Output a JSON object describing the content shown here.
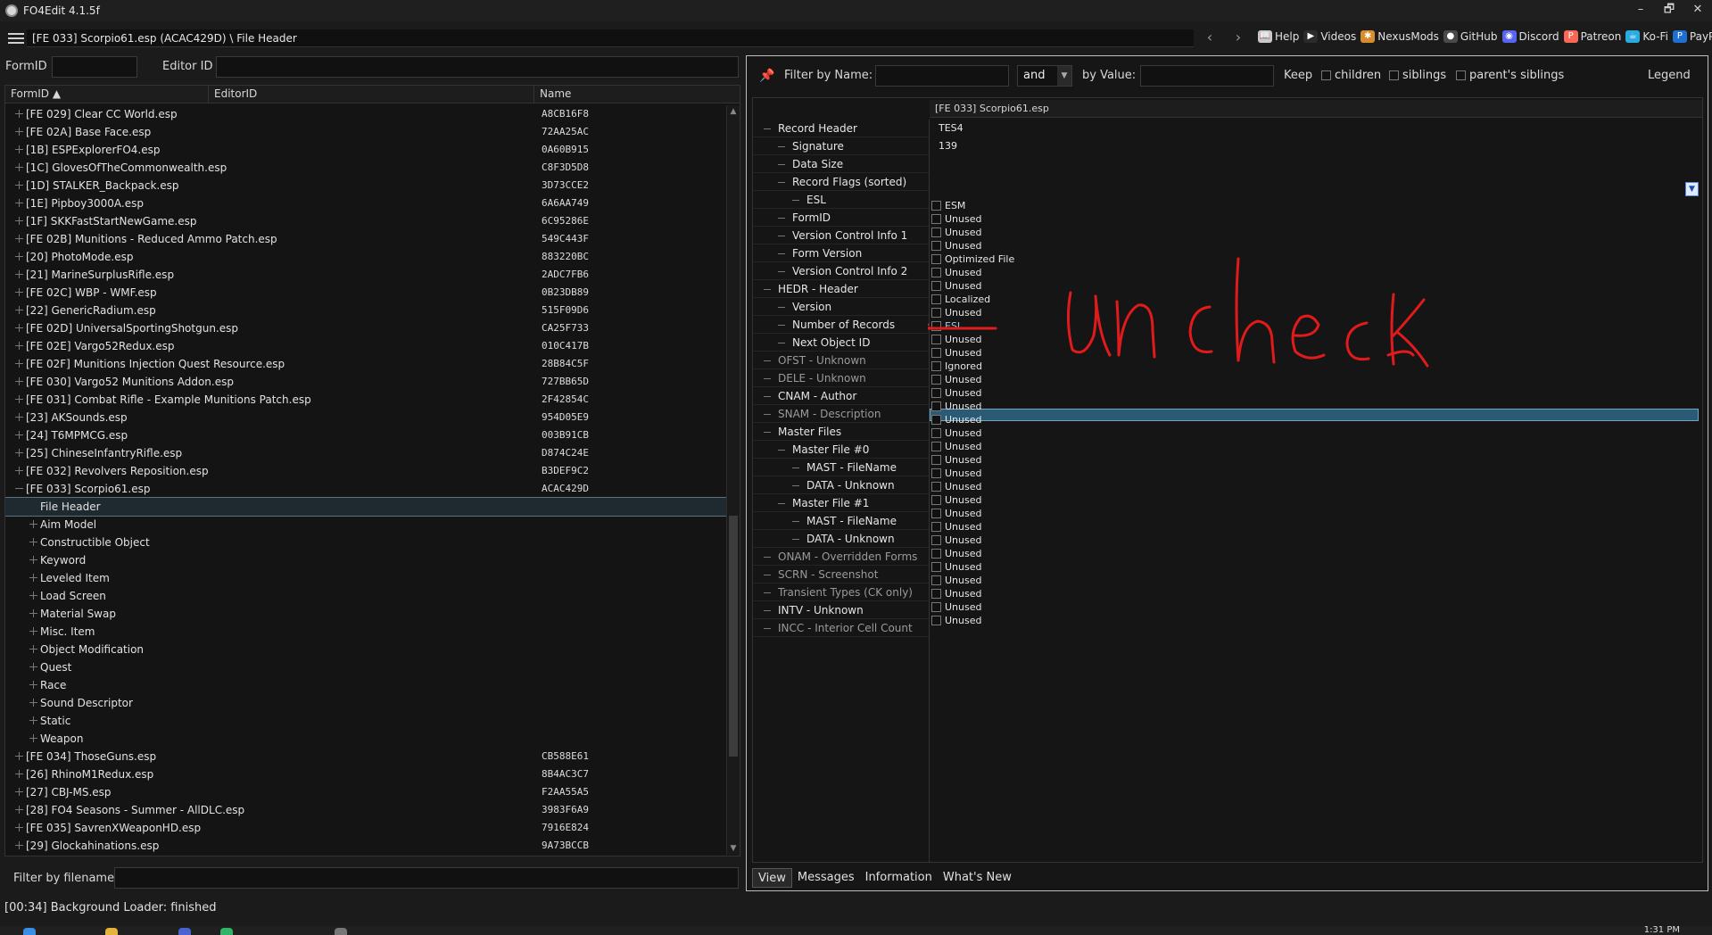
{
  "window": {
    "title": "FO4Edit 4.1.5f",
    "controls": [
      "–",
      "🗗",
      "✕"
    ]
  },
  "toolbar": {
    "breadcrumb": "[FE 033] Scorpio61.esp (ACAC429D) \\ File Header",
    "back": "‹",
    "forward": "›",
    "links": [
      {
        "label": "Help",
        "icon": "book-icon",
        "color": "#c9c9c9",
        "glyph": "📖"
      },
      {
        "label": "Videos",
        "icon": "videos-icon",
        "color": "#2b2b2b",
        "glyph": "▶"
      },
      {
        "label": "NexusMods",
        "icon": "nexus-icon",
        "color": "#d98c2b",
        "glyph": "✱"
      },
      {
        "label": "GitHub",
        "icon": "github-icon",
        "color": "#4a4a4a",
        "glyph": "●"
      },
      {
        "label": "Discord",
        "icon": "discord-icon",
        "color": "#5865f2",
        "glyph": "◉"
      },
      {
        "label": "Patreon",
        "icon": "patreon-icon",
        "color": "#f96854",
        "glyph": "P"
      },
      {
        "label": "Ko-Fi",
        "icon": "kofi-icon",
        "color": "#29abe0",
        "glyph": "☕"
      },
      {
        "label": "PayPal",
        "icon": "paypal-icon",
        "color": "#1f6fd1",
        "glyph": "P"
      }
    ]
  },
  "left": {
    "formid_label": "FormID",
    "editorid_label": "Editor ID",
    "columns": [
      "FormID",
      "EditorID",
      "Name"
    ],
    "rows": [
      {
        "name": "[FE 029] Clear CC World.esp",
        "value": "A8CB16F8",
        "depth": 0,
        "exp": "plus"
      },
      {
        "name": "[FE 02A] Base Face.esp",
        "value": "72AA25AC",
        "depth": 0,
        "exp": "plus"
      },
      {
        "name": "[1B] ESPExplorerFO4.esp",
        "value": "0A60B915",
        "depth": 0,
        "exp": "plus"
      },
      {
        "name": "[1C] GlovesOfTheCommonwealth.esp",
        "value": "C8F3D5D8",
        "depth": 0,
        "exp": "plus"
      },
      {
        "name": "[1D] STALKER_Backpack.esp",
        "value": "3D73CCE2",
        "depth": 0,
        "exp": "plus"
      },
      {
        "name": "[1E] Pipboy3000A.esp",
        "value": "6A6AA749",
        "depth": 0,
        "exp": "plus"
      },
      {
        "name": "[1F] SKKFastStartNewGame.esp",
        "value": "6C95286E",
        "depth": 0,
        "exp": "plus"
      },
      {
        "name": "[FE 02B] Munitions - Reduced Ammo Patch.esp",
        "value": "549C443F",
        "depth": 0,
        "exp": "plus"
      },
      {
        "name": "[20] PhotoMode.esp",
        "value": "883220BC",
        "depth": 0,
        "exp": "plus"
      },
      {
        "name": "[21] MarineSurplusRifle.esp",
        "value": "2ADC7FB6",
        "depth": 0,
        "exp": "plus"
      },
      {
        "name": "[FE 02C] WBP - WMF.esp",
        "value": "0B23DB89",
        "depth": 0,
        "exp": "plus"
      },
      {
        "name": "[22] GenericRadium.esp",
        "value": "515F09D6",
        "depth": 0,
        "exp": "plus"
      },
      {
        "name": "[FE 02D] UniversalSportingShotgun.esp",
        "value": "CA25F733",
        "depth": 0,
        "exp": "plus"
      },
      {
        "name": "[FE 02E] Vargo52Redux.esp",
        "value": "010C417B",
        "depth": 0,
        "exp": "plus"
      },
      {
        "name": "[FE 02F] Munitions Injection Quest Resource.esp",
        "value": "28B84C5F",
        "depth": 0,
        "exp": "plus"
      },
      {
        "name": "[FE 030] Vargo52 Munitions Addon.esp",
        "value": "727BB65D",
        "depth": 0,
        "exp": "plus"
      },
      {
        "name": "[FE 031] Combat Rifle - Example Munitions Patch.esp",
        "value": "2F42854C",
        "depth": 0,
        "exp": "plus"
      },
      {
        "name": "[23] AKSounds.esp",
        "value": "954D05E9",
        "depth": 0,
        "exp": "plus"
      },
      {
        "name": "[24] T6MPMCG.esp",
        "value": "003B91CB",
        "depth": 0,
        "exp": "plus"
      },
      {
        "name": "[25] ChineseInfantryRifle.esp",
        "value": "D874C24E",
        "depth": 0,
        "exp": "plus"
      },
      {
        "name": "[FE 032] Revolvers Reposition.esp",
        "value": "B3DEF9C2",
        "depth": 0,
        "exp": "plus"
      },
      {
        "name": "[FE 033] Scorpio61.esp",
        "value": "ACAC429D",
        "depth": 0,
        "exp": "minus"
      },
      {
        "name": "File Header",
        "value": "",
        "depth": 1,
        "exp": "none",
        "selected": true
      },
      {
        "name": "Aim Model",
        "value": "",
        "depth": 1,
        "exp": "plus"
      },
      {
        "name": "Constructible Object",
        "value": "",
        "depth": 1,
        "exp": "plus"
      },
      {
        "name": "Keyword",
        "value": "",
        "depth": 1,
        "exp": "plus"
      },
      {
        "name": "Leveled Item",
        "value": "",
        "depth": 1,
        "exp": "plus"
      },
      {
        "name": "Load Screen",
        "value": "",
        "depth": 1,
        "exp": "plus"
      },
      {
        "name": "Material Swap",
        "value": "",
        "depth": 1,
        "exp": "plus"
      },
      {
        "name": "Misc. Item",
        "value": "",
        "depth": 1,
        "exp": "plus"
      },
      {
        "name": "Object Modification",
        "value": "",
        "depth": 1,
        "exp": "plus"
      },
      {
        "name": "Quest",
        "value": "",
        "depth": 1,
        "exp": "plus"
      },
      {
        "name": "Race",
        "value": "",
        "depth": 1,
        "exp": "plus"
      },
      {
        "name": "Sound Descriptor",
        "value": "",
        "depth": 1,
        "exp": "plus"
      },
      {
        "name": "Static",
        "value": "",
        "depth": 1,
        "exp": "plus"
      },
      {
        "name": "Weapon",
        "value": "",
        "depth": 1,
        "exp": "plus"
      },
      {
        "name": "[FE 034] ThoseGuns.esp",
        "value": "CB588E61",
        "depth": 0,
        "exp": "plus"
      },
      {
        "name": "[26] RhinoM1Redux.esp",
        "value": "8B4AC3C7",
        "depth": 0,
        "exp": "plus"
      },
      {
        "name": "[27] CBJ-MS.esp",
        "value": "F2AA55A5",
        "depth": 0,
        "exp": "plus"
      },
      {
        "name": "[28] FO4 Seasons - Summer - AllDLC.esp",
        "value": "3983F6A9",
        "depth": 0,
        "exp": "plus"
      },
      {
        "name": "[FE 035] SavrenXWeaponHD.esp",
        "value": "7916E824",
        "depth": 0,
        "exp": "plus"
      },
      {
        "name": "[29] Glockahinations.esp",
        "value": "9A73BCCB",
        "depth": 0,
        "exp": "plus"
      }
    ],
    "filter_by_filename_label": "Filter by filename:",
    "status": "[00:34] Background Loader: finished"
  },
  "right": {
    "filter_name_label": "Filter by Name:",
    "and_value": "and",
    "by_value_label": "by Value:",
    "keep_label": "Keep",
    "children_label": "children",
    "siblings_label": "siblings",
    "parents_siblings_label": "parent's siblings",
    "legend_label": "Legend",
    "column_header": "[FE 033] Scorpio61.esp",
    "tree": [
      {
        "label": "Record Header",
        "depth": 0,
        "dim": false
      },
      {
        "label": "Signature",
        "depth": 1,
        "dim": false
      },
      {
        "label": "Data Size",
        "depth": 1,
        "dim": false
      },
      {
        "label": "Record Flags (sorted)",
        "depth": 1,
        "dim": false
      },
      {
        "label": "ESL",
        "depth": 2,
        "dim": false
      },
      {
        "label": "FormID",
        "depth": 1,
        "dim": false
      },
      {
        "label": "Version Control Info 1",
        "depth": 1,
        "dim": false
      },
      {
        "label": "Form Version",
        "depth": 1,
        "dim": false
      },
      {
        "label": "Version Control Info 2",
        "depth": 1,
        "dim": false
      },
      {
        "label": "HEDR - Header",
        "depth": 0,
        "dim": false
      },
      {
        "label": "Version",
        "depth": 1,
        "dim": false
      },
      {
        "label": "Number of Records",
        "depth": 1,
        "dim": false
      },
      {
        "label": "Next Object ID",
        "depth": 1,
        "dim": false
      },
      {
        "label": "OFST - Unknown",
        "depth": 0,
        "dim": true
      },
      {
        "label": "DELE - Unknown",
        "depth": 0,
        "dim": true
      },
      {
        "label": "CNAM - Author",
        "depth": 0,
        "dim": false
      },
      {
        "label": "SNAM - Description",
        "depth": 0,
        "dim": true
      },
      {
        "label": "Master Files",
        "depth": 0,
        "dim": false
      },
      {
        "label": "Master File #0",
        "depth": 1,
        "dim": false
      },
      {
        "label": "MAST - FileName",
        "depth": 2,
        "dim": false
      },
      {
        "label": "DATA - Unknown",
        "depth": 2,
        "dim": false
      },
      {
        "label": "Master File #1",
        "depth": 1,
        "dim": false
      },
      {
        "label": "MAST - FileName",
        "depth": 2,
        "dim": false
      },
      {
        "label": "DATA - Unknown",
        "depth": 2,
        "dim": false
      },
      {
        "label": "ONAM - Overridden Forms",
        "depth": 0,
        "dim": true
      },
      {
        "label": "SCRN - Screenshot",
        "depth": 0,
        "dim": true
      },
      {
        "label": "Transient Types (CK only)",
        "depth": 0,
        "dim": true
      },
      {
        "label": "INTV - Unknown",
        "depth": 0,
        "dim": false
      },
      {
        "label": "INCC - Interior Cell Count",
        "depth": 0,
        "dim": true
      }
    ],
    "values": {
      "signature": "TES4",
      "data_size": "139"
    },
    "flags": [
      "ESM",
      "Unused",
      "Unused",
      "Unused",
      "Optimized File",
      "Unused",
      "Unused",
      "Localized",
      "Unused",
      "ESL",
      "Unused",
      "Unused",
      "Ignored",
      "Unused",
      "Unused",
      "Unused",
      "Unused",
      "Unused",
      "Unused",
      "Unused",
      "Unused",
      "Unused",
      "Unused",
      "Unused",
      "Unused",
      "Unused",
      "Unused",
      "Unused",
      "Unused",
      "Unused",
      "Unused",
      "Unused"
    ],
    "highlighted_flag": "ESL",
    "tabs": [
      "View",
      "Messages",
      "Information",
      "What's New"
    ]
  },
  "annotation": {
    "text": "uncheck",
    "color": "#e11b1b"
  },
  "taskbar": {
    "clock": "1:31 PM"
  }
}
